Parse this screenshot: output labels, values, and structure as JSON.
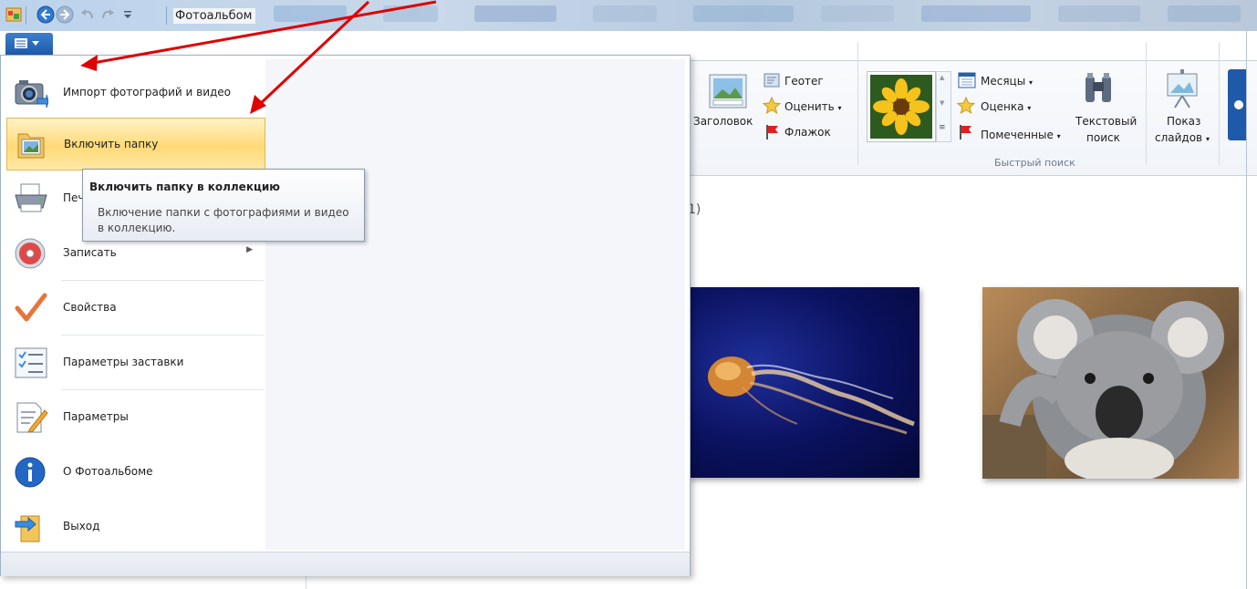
{
  "window": {
    "title": "Фотоальбом"
  },
  "quick_access": [
    "app-icon",
    "back-icon",
    "forward-icon",
    "undo-icon",
    "redo-icon",
    "customize-icon"
  ],
  "app_menu": {
    "items": [
      {
        "label": "Импорт фотографий и видео",
        "icon": "camera-import-icon"
      },
      {
        "label": "Включить папку",
        "icon": "folder-include-icon"
      },
      {
        "label": "Печать",
        "icon": "printer-icon"
      },
      {
        "label": "Записать",
        "icon": "disc-burn-icon"
      },
      {
        "label": "Свойства",
        "icon": "checkmark-icon"
      },
      {
        "label": "Параметры заставки",
        "icon": "screensaver-list-icon"
      },
      {
        "label": "Параметры",
        "icon": "options-icon"
      },
      {
        "label": "О Фотоальбоме",
        "icon": "info-icon"
      },
      {
        "label": "Выход",
        "icon": "exit-icon"
      }
    ],
    "visible_print_label": "Печ"
  },
  "tooltip": {
    "title": "Включить папку в коллекцию",
    "body": "Включение папки с фотографиями и видео в коллекцию."
  },
  "ribbon": {
    "caption_button": "Заголовок",
    "geotag": "Геотег",
    "rate": "Оценить",
    "flag": "Флажок",
    "months": "Месяцы",
    "rating": "Оценка",
    "flagged": "Помеченные",
    "text_search_1": "Текстовый",
    "text_search_2": "поиск",
    "slideshow_1": "Показ",
    "slideshow_2": "слайдов",
    "group_label": "Быстрый поиск"
  },
  "content": {
    "count_text": "1)"
  },
  "colors": {
    "accent": "#1e5aa9",
    "highlight": "#ffd977",
    "annotation": "#e00000"
  }
}
